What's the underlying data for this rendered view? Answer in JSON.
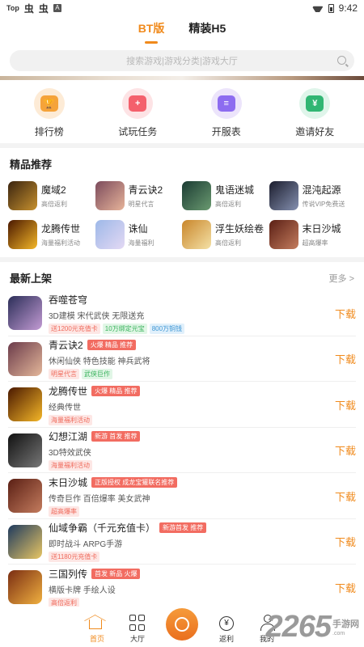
{
  "status": {
    "left_label": "Top",
    "bug1": "虫",
    "bug2": "虫",
    "a_box": "A",
    "time": "9:42"
  },
  "tabs": [
    {
      "label": "BT版"
    },
    {
      "label": "精装H5"
    }
  ],
  "search": {
    "placeholder": "搜索游戏|游戏分类|游戏大厅"
  },
  "quick": [
    {
      "label": "排行榜",
      "icon": "trophy-icon",
      "bg": "#fdebd6",
      "fg": "#f5a33a",
      "glyph": "🏆"
    },
    {
      "label": "试玩任务",
      "icon": "gamepad-icon",
      "bg": "#fde3e5",
      "fg": "#f4606c",
      "glyph": "+"
    },
    {
      "label": "开服表",
      "icon": "server-list-icon",
      "bg": "#ece4fb",
      "fg": "#8d6cf0",
      "glyph": "≡"
    },
    {
      "label": "邀请好友",
      "icon": "invite-money-icon",
      "bg": "#dff5ea",
      "fg": "#31b673",
      "glyph": "¥"
    }
  ],
  "recommend": {
    "title": "精品推荐",
    "items": [
      {
        "name": "魔域2",
        "sub": "高倍返利",
        "c1": "#3a2410",
        "c2": "#c7912e"
      },
      {
        "name": "青云诀2",
        "sub": "明星代言",
        "c1": "#7c4b5c",
        "c2": "#e7b49a"
      },
      {
        "name": "鬼语迷城",
        "sub": "高倍返利",
        "c1": "#1b3b33",
        "c2": "#6a9a70"
      },
      {
        "name": "混沌起源",
        "sub": "传说VIP免费送",
        "c1": "#1b1d2d",
        "c2": "#8590b0"
      },
      {
        "name": "龙腾传世",
        "sub": "海量福利活动",
        "c1": "#4a1800",
        "c2": "#f4b728"
      },
      {
        "name": "诛仙",
        "sub": "海量福利",
        "c1": "#9db8e8",
        "c2": "#e4d9f4"
      },
      {
        "name": "浮生妖绘卷",
        "sub": "高倍返利",
        "c1": "#c9862b",
        "c2": "#f4e1a6"
      },
      {
        "name": "末日沙城",
        "sub": "超高爆率",
        "c1": "#5a1f14",
        "c2": "#c47c5e"
      }
    ]
  },
  "new_list": {
    "title": "最新上架",
    "more": "更多 >",
    "download_label": "下载",
    "items": [
      {
        "name": "吞噬苍穹",
        "badge": "",
        "desc": "3D建模 宋代武侠 无限送充",
        "chips": [
          {
            "text": "送1200元充值卡",
            "type": "pink"
          },
          {
            "text": "10万绑定元宝",
            "type": "green"
          },
          {
            "text": "800万铜钱",
            "type": "blue"
          }
        ],
        "c1": "#2b2e58",
        "c2": "#c39bd4"
      },
      {
        "name": "青云诀2",
        "badge": "火爆 精品 推荐",
        "desc": "休闲仙侠 特色技能 神兵武将",
        "chips": [
          {
            "text": "明星代言",
            "type": "pink"
          },
          {
            "text": "武侠巨作",
            "type": "green"
          }
        ],
        "c1": "#6b3b4a",
        "c2": "#e4b79a"
      },
      {
        "name": "龙腾传世",
        "badge": "火爆 精品 推荐",
        "desc": "经典传世",
        "chips": [
          {
            "text": "海量福利活动",
            "type": "pink"
          }
        ],
        "c1": "#4a1800",
        "c2": "#f4b728"
      },
      {
        "name": "幻想江湖",
        "badge": "新游 首发 推荐",
        "desc": "3D特效武侠",
        "chips": [
          {
            "text": "海量福利活动",
            "type": "pink"
          }
        ],
        "c1": "#111111",
        "c2": "#777777"
      },
      {
        "name": "末日沙城",
        "badge": "正版授权 成龙宝獾联名推荐",
        "desc": "传奇巨作 百倍爆率 美女武神",
        "chips": [
          {
            "text": "超高爆率",
            "type": "pink"
          }
        ],
        "c1": "#5a1f14",
        "c2": "#c47c5e"
      },
      {
        "name": "仙域争霸（千元充值卡）",
        "badge": "新游首发 推荐",
        "desc": "即时战斗 ARPG手游",
        "chips": [
          {
            "text": "送1180元充值卡",
            "type": "pink"
          }
        ],
        "c1": "#1e3a5e",
        "c2": "#e8c664"
      },
      {
        "name": "三国列传",
        "badge": "首发 新品 火爆",
        "desc": "横版卡牌 手绘人设",
        "chips": [
          {
            "text": "高倍返利",
            "type": "pink"
          }
        ],
        "c1": "#7a2d12",
        "c2": "#f0b040"
      }
    ]
  },
  "bottom_nav": [
    {
      "label": "首页",
      "icon": "home-icon",
      "active": true
    },
    {
      "label": "大厅",
      "icon": "grid-icon",
      "active": false
    },
    {
      "label": "",
      "icon": "coin-center-icon",
      "active": false
    },
    {
      "label": "返利",
      "icon": "yen-circle-icon",
      "active": false
    },
    {
      "label": "我的",
      "icon": "user-icon",
      "active": false
    }
  ],
  "watermark": {
    "number": "2265",
    "text": "手游网",
    "small": ".com"
  }
}
